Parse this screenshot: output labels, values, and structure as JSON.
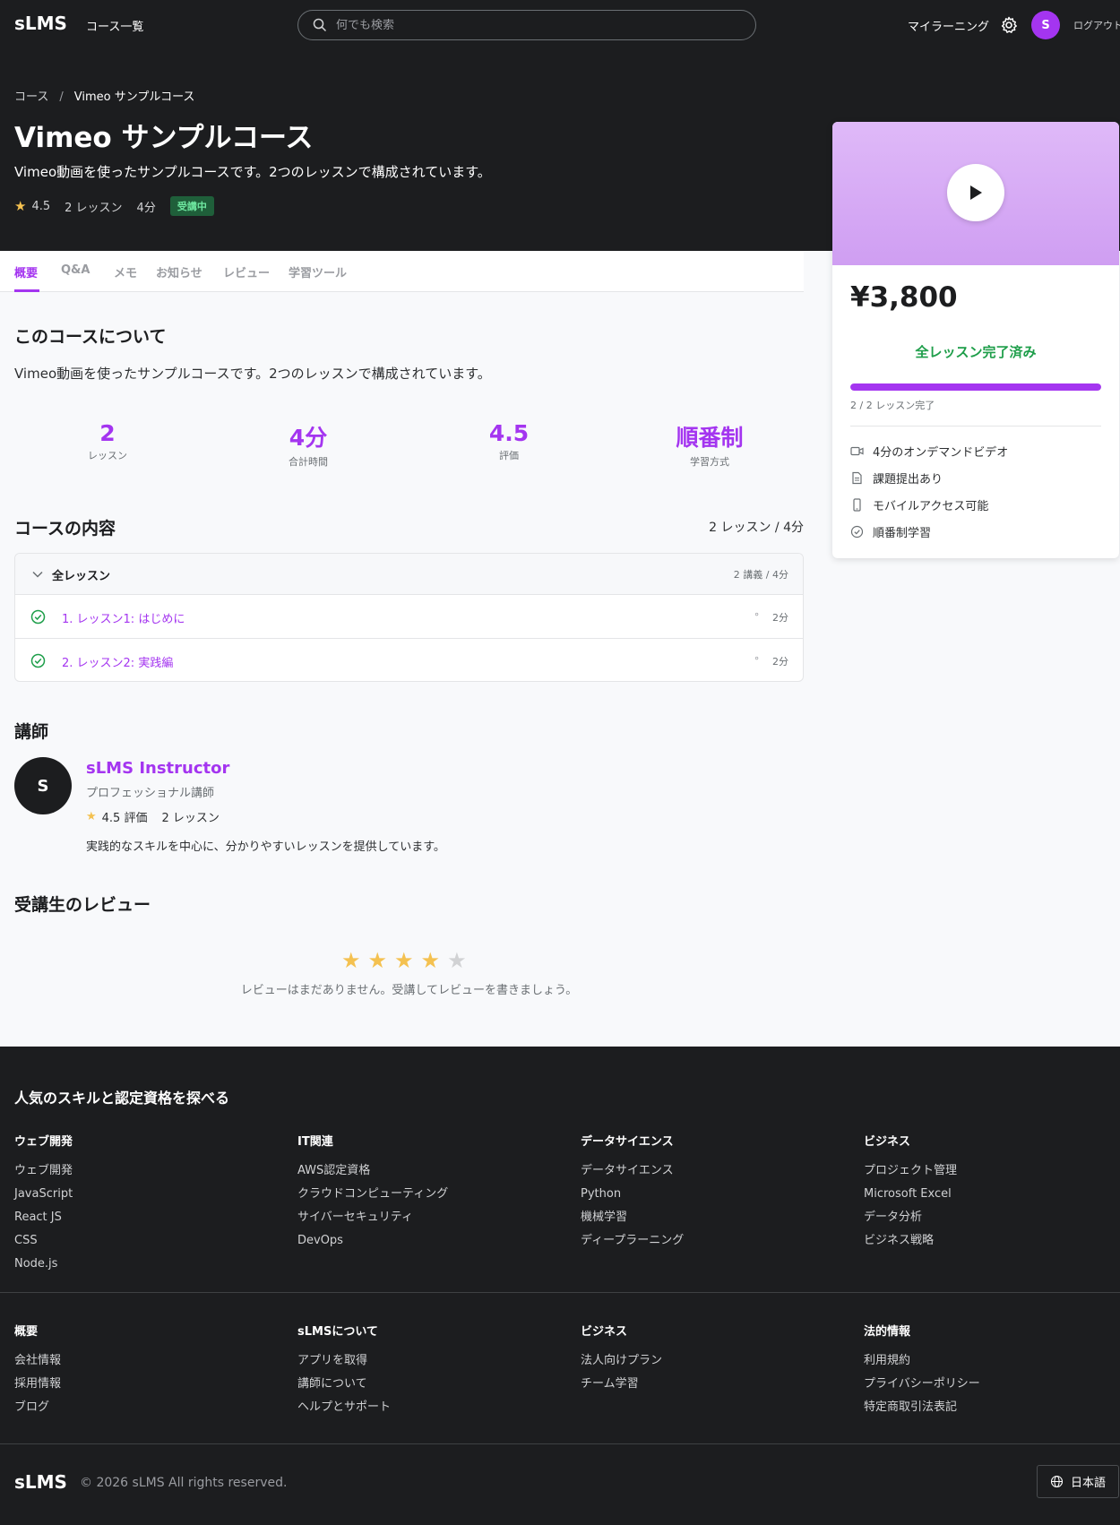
{
  "nav": {
    "logo": "sLMS",
    "courses_link": "コース一覧",
    "search_placeholder": "何でも検索",
    "my_learning": "マイラーニング",
    "avatar_initial": "S",
    "logout": "ログアウト"
  },
  "hero": {
    "breadcrumb": [
      "コース",
      "/",
      "Vimeo サンプルコース"
    ],
    "title": "Vimeo サンプルコース",
    "subtitle": "Vimeo動画を使ったサンプルコースです。2つのレッスンで構成されています。",
    "rating": "4.5",
    "lessons": "2 レッスン",
    "duration": "4分",
    "badge": "受講中"
  },
  "tabs": [
    "概要",
    "Q&A",
    "メモ",
    "お知らせ",
    "レビュー",
    "学習ツール"
  ],
  "about": {
    "heading": "このコースについて",
    "text": "Vimeo動画を使ったサンプルコースです。2つのレッスンで構成されています。",
    "stats": [
      {
        "value": "2",
        "label": "レッスン"
      },
      {
        "value": "4分",
        "label": "合計時間"
      },
      {
        "value": "4.5",
        "label": "評価"
      },
      {
        "value": "順番制",
        "label": "学習方式"
      }
    ]
  },
  "content": {
    "heading": "コースの内容",
    "summary": "2 レッスン / 4分",
    "section_label": "全レッスン",
    "section_count": "2 講義 / 4分",
    "lessons": [
      {
        "name": "1. レッスン1: はじめに",
        "dot": "∘",
        "duration": "2分"
      },
      {
        "name": "2. レッスン2: 実践編",
        "dot": "∘",
        "duration": "2分"
      }
    ]
  },
  "instructor": {
    "heading": "講師",
    "initial": "S",
    "name": "sLMS Instructor",
    "title": "プロフェッショナル講師",
    "rating": "4.5 評価",
    "lessons": "2 レッスン",
    "bio": "実践的なスキルを中心に、分かりやすいレッスンを提供しています。"
  },
  "reviews": {
    "heading": "受講生のレビュー",
    "stars_filled": 4,
    "stars_total": 5,
    "empty_text": "レビューはまだありません。受講してレビューを書きましょう。"
  },
  "card": {
    "price": "¥3,800",
    "status": "全レッスン完了済み",
    "progress_fraction": 1.0,
    "progress_text": "2 / 2 レッスン完了",
    "features": [
      {
        "icon": "video-icon",
        "label": "4分のオンデマンドビデオ"
      },
      {
        "icon": "document-icon",
        "label": "課題提出あり"
      },
      {
        "icon": "mobile-icon",
        "label": "モバイルアクセス可能"
      },
      {
        "icon": "check-circle-icon",
        "label": "順番制学習"
      }
    ]
  },
  "footer": {
    "heading": "人気のスキルと認定資格を探べる",
    "skill_columns": [
      {
        "title": "ウェブ開発",
        "items": [
          "ウェブ開発",
          "JavaScript",
          "React JS",
          "CSS",
          "Node.js"
        ]
      },
      {
        "title": "IT関連",
        "items": [
          "AWS認定資格",
          "クラウドコンピューティング",
          "サイバーセキュリティ",
          "DevOps"
        ]
      },
      {
        "title": "データサイエンス",
        "items": [
          "データサイエンス",
          "Python",
          "機械学習",
          "ディープラーニング"
        ]
      },
      {
        "title": "ビジネス",
        "items": [
          "プロジェクト管理",
          "Microsoft Excel",
          "データ分析",
          "ビジネス戦略"
        ]
      }
    ],
    "link_columns": [
      {
        "title": "概要",
        "items": [
          "会社情報",
          "採用情報",
          "ブログ"
        ]
      },
      {
        "title": "sLMSについて",
        "items": [
          "アプリを取得",
          "講師について",
          "ヘルプとサポート"
        ]
      },
      {
        "title": "ビジネス",
        "items": [
          "法人向けプラン",
          "チーム学習"
        ]
      },
      {
        "title": "法的情報",
        "items": [
          "利用規約",
          "プライバシーポリシー",
          "特定商取引法表記"
        ]
      }
    ],
    "logo": "sLMS",
    "copyright": "© 2026 sLMS All rights reserved.",
    "language": "日本語"
  },
  "colors": {
    "accent": "#a435f0",
    "dark": "#1c1d1f",
    "success": "#1e9e4a",
    "star": "#f4c150"
  }
}
